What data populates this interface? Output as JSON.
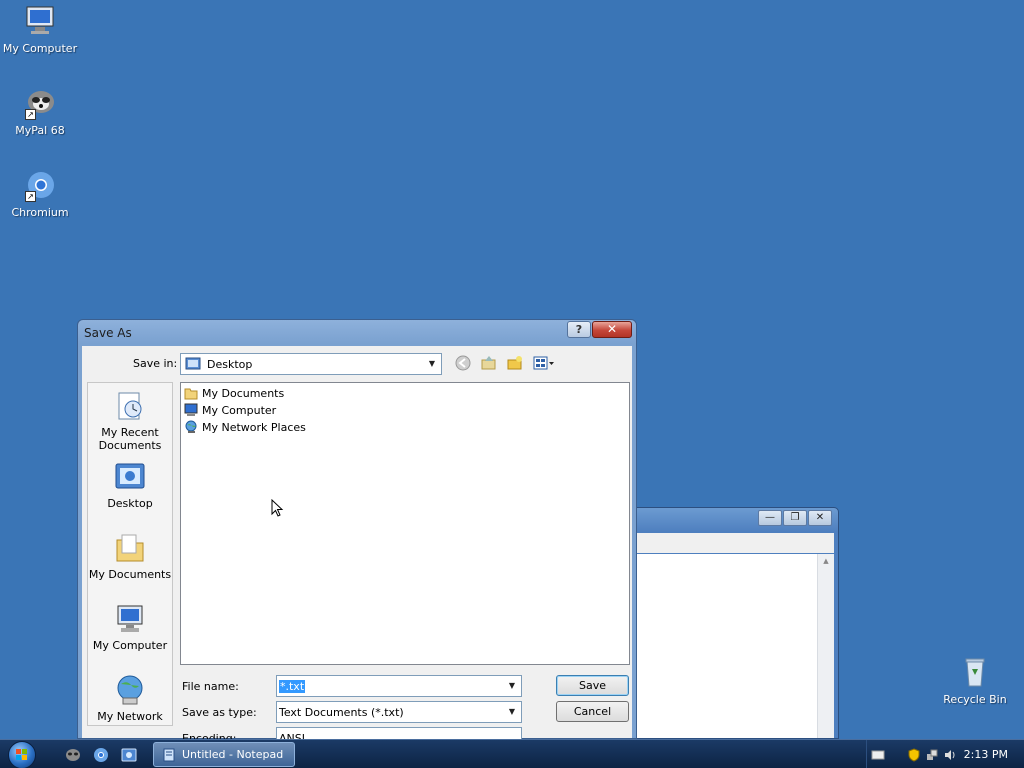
{
  "desktop": {
    "icons": [
      {
        "label": "My Computer"
      },
      {
        "label": "MyPal 68"
      },
      {
        "label": "Chromium"
      },
      {
        "label": "Recycle Bin"
      }
    ]
  },
  "dialog": {
    "title": "Save As",
    "help_glyph": "?",
    "close_glyph": "✕",
    "save_in_label": "Save in:",
    "save_in_value": "Desktop",
    "places": [
      {
        "label": "My Recent Documents"
      },
      {
        "label": "Desktop"
      },
      {
        "label": "My Documents"
      },
      {
        "label": "My Computer"
      },
      {
        "label": "My Network"
      }
    ],
    "files": [
      {
        "name": "My Documents"
      },
      {
        "name": "My Computer"
      },
      {
        "name": "My Network Places"
      }
    ],
    "file_name_label": "File name:",
    "file_name_value": "*.txt",
    "save_as_type_label": "Save as type:",
    "save_as_type_value": "Text Documents (*.txt)",
    "encoding_label": "Encoding:",
    "encoding_value": "ANSI",
    "save_button": "Save",
    "cancel_button": "Cancel"
  },
  "notepad_window": {
    "minimize": "—",
    "maximize": "❐",
    "close": "✕"
  },
  "taskbar": {
    "active_task": "Untitled - Notepad",
    "clock": "2:13 PM"
  }
}
